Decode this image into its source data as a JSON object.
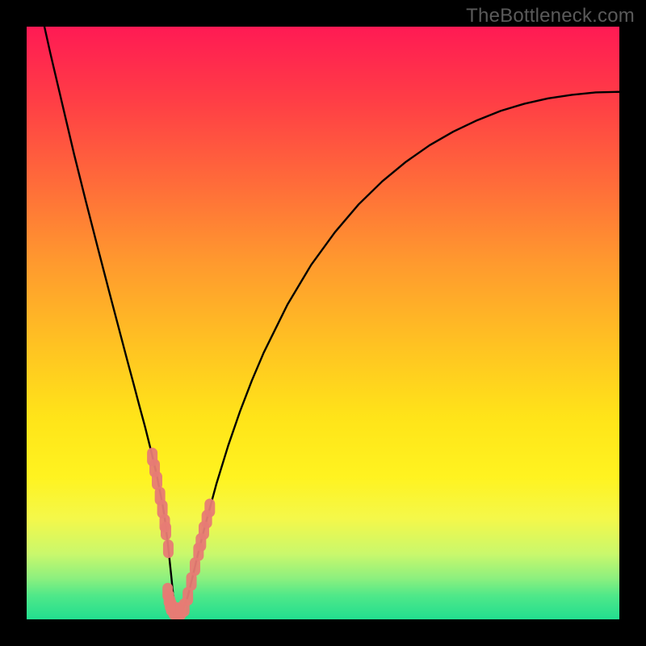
{
  "watermark": "TheBottleneck.com",
  "chart_data": {
    "type": "line",
    "title": "",
    "xlabel": "",
    "ylabel": "",
    "xlim": [
      0,
      100
    ],
    "ylim": [
      0,
      100
    ],
    "grid": false,
    "legend": false,
    "series": [
      {
        "name": "curve",
        "color": "#000000",
        "x": [
          3,
          4,
          6,
          8,
          10,
          12,
          14,
          16,
          17,
          18,
          19,
          20,
          21,
          21.5,
          22,
          23,
          23.4,
          23.8,
          24.4,
          25,
          25.6,
          26.4,
          27.2,
          28,
          29,
          30,
          32,
          34,
          36,
          38,
          40,
          44,
          48,
          52,
          56,
          60,
          64,
          68,
          72,
          76,
          80,
          84,
          88,
          92,
          96,
          100
        ],
        "y": [
          100,
          95.5,
          87,
          78.5,
          70.5,
          62.7,
          55,
          47.4,
          43.6,
          39.9,
          36.1,
          32.4,
          28.4,
          26.3,
          24.1,
          19,
          16.3,
          13,
          7.3,
          1.3,
          1.3,
          1.8,
          3.9,
          7.2,
          11.4,
          15.4,
          22.8,
          29.3,
          35.1,
          40.3,
          45,
          53.1,
          59.8,
          65.3,
          70,
          73.9,
          77.2,
          80,
          82.3,
          84.2,
          85.8,
          87,
          87.9,
          88.5,
          88.9,
          89
        ]
      },
      {
        "name": "markers-left",
        "color": "#e77b74",
        "type": "scatter",
        "x": [
          21.2,
          21.6,
          22.0,
          22.5,
          22.9,
          23.3,
          23.5,
          23.9
        ],
        "y": [
          27.4,
          25.5,
          23.4,
          20.8,
          18.6,
          16.2,
          14.9,
          11.9
        ]
      },
      {
        "name": "markers-right",
        "color": "#e77b74",
        "type": "scatter",
        "x": [
          27.2,
          27.8,
          28.4,
          29.0,
          29.4,
          29.9,
          30.4,
          30.9
        ],
        "y": [
          3.9,
          6.4,
          8.9,
          11.4,
          13.0,
          15.0,
          16.9,
          18.8
        ]
      },
      {
        "name": "markers-bottom-band",
        "color": "#e77b74",
        "type": "scatter",
        "x": [
          24.4,
          24.8,
          25.2,
          25.6,
          26.0,
          26.6
        ],
        "y": [
          2.1,
          1.5,
          1.3,
          1.3,
          1.4,
          2.0
        ]
      },
      {
        "name": "markers-bottom-extra",
        "color": "#e77b74",
        "type": "scatter",
        "x": [
          23.8,
          24.0,
          24.2
        ],
        "y": [
          4.6,
          3.5,
          2.7
        ]
      }
    ]
  }
}
